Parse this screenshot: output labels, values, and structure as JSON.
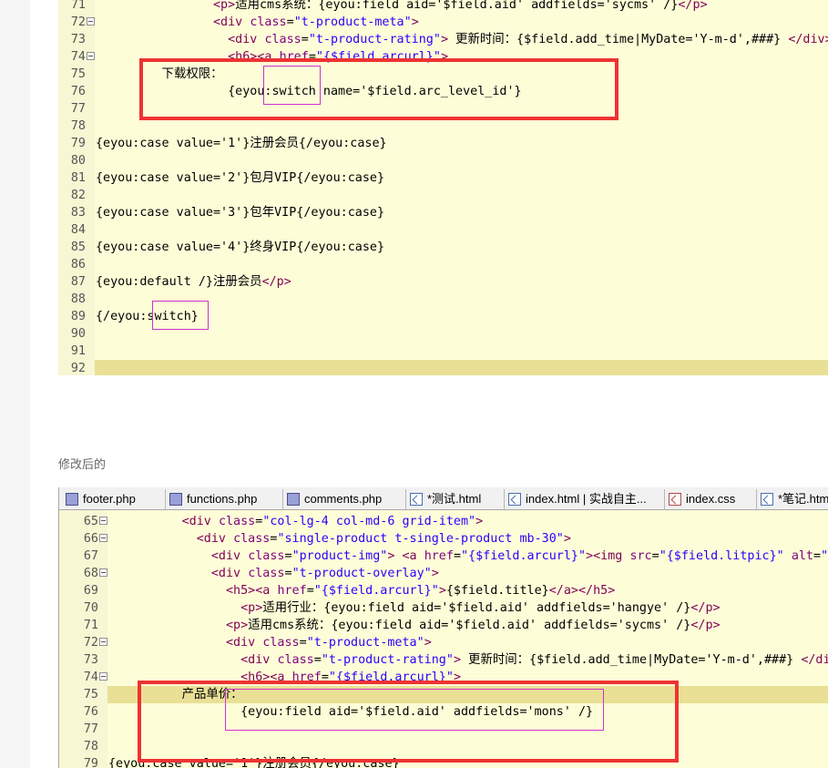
{
  "editor1": {
    "lines": [
      {
        "n": "71",
        "tokens": [
          [
            "",
            "                "
          ],
          [
            "k",
            "<p>"
          ],
          [
            "",
            "适用cms系统：{eyou:field aid='$field.aid' addfields='sycms' /}"
          ],
          [
            "k",
            "</p>"
          ]
        ]
      },
      {
        "n": "72",
        "fold": true,
        "tokens": [
          [
            "",
            "                "
          ],
          [
            "k",
            "<div "
          ],
          [
            "a",
            "class"
          ],
          [
            "",
            "="
          ],
          [
            "s",
            "\"t-product-meta\""
          ],
          [
            "k",
            ">"
          ]
        ]
      },
      {
        "n": "73",
        "tokens": [
          [
            "",
            "                  "
          ],
          [
            "k",
            "<div "
          ],
          [
            "a",
            "class"
          ],
          [
            "",
            "="
          ],
          [
            "s",
            "\"t-product-rating\""
          ],
          [
            "k",
            ">"
          ],
          [
            "",
            " 更新时间：{$field.add_time|MyDate='Y-m-d',###} "
          ],
          [
            "k",
            "</div>"
          ]
        ]
      },
      {
        "n": "74",
        "fold": true,
        "tokens": [
          [
            "",
            "                  "
          ],
          [
            "k",
            "<h6><a "
          ],
          [
            "a",
            "href"
          ],
          [
            "",
            "="
          ],
          [
            "s",
            "\"{$field.arcurl}\""
          ],
          [
            "k",
            ">"
          ]
        ]
      },
      {
        "n": "75",
        "tokens": [
          [
            "",
            "         下载权限："
          ]
        ]
      },
      {
        "n": "76",
        "tokens": [
          [
            "",
            "                  {eyou:switch name='$field.arc_level_id'}"
          ]
        ]
      },
      {
        "n": "77",
        "tokens": [
          [
            "",
            ""
          ]
        ]
      },
      {
        "n": "78",
        "tokens": [
          [
            "",
            ""
          ]
        ]
      },
      {
        "n": "79",
        "tokens": [
          [
            "",
            "{eyou:case value='1'}注册会员{/eyou:case}"
          ]
        ]
      },
      {
        "n": "80",
        "tokens": [
          [
            "",
            ""
          ]
        ]
      },
      {
        "n": "81",
        "tokens": [
          [
            "",
            "{eyou:case value='2'}包月VIP{/eyou:case}"
          ]
        ]
      },
      {
        "n": "82",
        "tokens": [
          [
            "",
            ""
          ]
        ]
      },
      {
        "n": "83",
        "tokens": [
          [
            "",
            "{eyou:case value='3'}包年VIP{/eyou:case}"
          ]
        ]
      },
      {
        "n": "84",
        "tokens": [
          [
            "",
            ""
          ]
        ]
      },
      {
        "n": "85",
        "tokens": [
          [
            "",
            "{eyou:case value='4'}终身VIP{/eyou:case}"
          ]
        ]
      },
      {
        "n": "86",
        "tokens": [
          [
            "",
            ""
          ]
        ]
      },
      {
        "n": "87",
        "tokens": [
          [
            "",
            "{eyou:default /}注册会员"
          ],
          [
            "k",
            "</p>"
          ]
        ]
      },
      {
        "n": "88",
        "tokens": [
          [
            "",
            ""
          ]
        ]
      },
      {
        "n": "89",
        "tokens": [
          [
            "",
            "{/eyou:switch}"
          ]
        ]
      },
      {
        "n": "90",
        "tokens": [
          [
            "",
            ""
          ]
        ]
      },
      {
        "n": "91",
        "tokens": [
          [
            "",
            ""
          ]
        ]
      },
      {
        "n": "92",
        "current": true,
        "tokens": [
          [
            "",
            ""
          ]
        ]
      }
    ]
  },
  "caption": "修改后的",
  "editor2": {
    "tabs": [
      {
        "label": "footer.php",
        "icon": "php-file-icon",
        "type": "php"
      },
      {
        "label": "functions.php",
        "icon": "php-file-icon",
        "type": "php"
      },
      {
        "label": "comments.php",
        "icon": "php-file-icon",
        "type": "php"
      },
      {
        "label": "*测试.html",
        "icon": "html-file-icon",
        "type": "html"
      },
      {
        "label": "index.html | 实战自主...",
        "icon": "html-file-icon",
        "type": "html"
      },
      {
        "label": "index.css",
        "icon": "css-file-icon",
        "type": "css"
      },
      {
        "label": "*笔记.html",
        "icon": "html-file-icon",
        "type": "html"
      }
    ],
    "lines": [
      {
        "n": "65",
        "fold": true,
        "tokens": [
          [
            "",
            "          "
          ],
          [
            "k",
            "<div "
          ],
          [
            "a",
            "class"
          ],
          [
            "",
            "="
          ],
          [
            "s",
            "\"col-lg-4 col-md-6 grid-item\""
          ],
          [
            "k",
            ">"
          ]
        ]
      },
      {
        "n": "66",
        "fold": true,
        "tokens": [
          [
            "",
            "            "
          ],
          [
            "k",
            "<div "
          ],
          [
            "a",
            "class"
          ],
          [
            "",
            "="
          ],
          [
            "s",
            "\"single-product t-single-product mb-30\""
          ],
          [
            "k",
            ">"
          ]
        ]
      },
      {
        "n": "67",
        "tokens": [
          [
            "",
            "              "
          ],
          [
            "k",
            "<div "
          ],
          [
            "a",
            "class"
          ],
          [
            "",
            "="
          ],
          [
            "s",
            "\"product-img\""
          ],
          [
            "k",
            "> <a "
          ],
          [
            "a",
            "href"
          ],
          [
            "",
            "="
          ],
          [
            "s",
            "\"{$field.arcurl}\""
          ],
          [
            "k",
            "><img "
          ],
          [
            "a",
            "src"
          ],
          [
            "",
            "="
          ],
          [
            "s",
            "\"{$field.litpic}\""
          ],
          [
            "",
            " "
          ],
          [
            "a",
            "alt"
          ],
          [
            "",
            "="
          ],
          [
            "s",
            "\"{"
          ]
        ]
      },
      {
        "n": "68",
        "fold": true,
        "tokens": [
          [
            "",
            "              "
          ],
          [
            "k",
            "<div "
          ],
          [
            "a",
            "class"
          ],
          [
            "",
            "="
          ],
          [
            "s",
            "\"t-product-overlay\""
          ],
          [
            "k",
            ">"
          ]
        ]
      },
      {
        "n": "69",
        "tokens": [
          [
            "",
            "                "
          ],
          [
            "k",
            "<h5><a "
          ],
          [
            "a",
            "href"
          ],
          [
            "",
            "="
          ],
          [
            "s",
            "\"{$field.arcurl}\""
          ],
          [
            "k",
            ">"
          ],
          [
            "",
            "{$field.title}"
          ],
          [
            "k",
            "</a></h5>"
          ]
        ]
      },
      {
        "n": "70",
        "tokens": [
          [
            "",
            "                  "
          ],
          [
            "k",
            "<p>"
          ],
          [
            "",
            "适用行业：{eyou:field aid='$field.aid' addfields='hangye' /}"
          ],
          [
            "k",
            "</p>"
          ]
        ]
      },
      {
        "n": "71",
        "tokens": [
          [
            "",
            "                "
          ],
          [
            "k",
            "<p>"
          ],
          [
            "",
            "适用cms系统：{eyou:field aid='$field.aid' addfields='sycms' /}"
          ],
          [
            "k",
            "</p>"
          ]
        ]
      },
      {
        "n": "72",
        "fold": true,
        "tokens": [
          [
            "",
            "                "
          ],
          [
            "k",
            "<div "
          ],
          [
            "a",
            "class"
          ],
          [
            "",
            "="
          ],
          [
            "s",
            "\"t-product-meta\""
          ],
          [
            "k",
            ">"
          ]
        ]
      },
      {
        "n": "73",
        "tokens": [
          [
            "",
            "                  "
          ],
          [
            "k",
            "<div "
          ],
          [
            "a",
            "class"
          ],
          [
            "",
            "="
          ],
          [
            "s",
            "\"t-product-rating\""
          ],
          [
            "k",
            ">"
          ],
          [
            "",
            " 更新时间：{$field.add_time|MyDate='Y-m-d',###} "
          ],
          [
            "k",
            "</di"
          ]
        ]
      },
      {
        "n": "74",
        "fold": true,
        "tokens": [
          [
            "",
            "                  "
          ],
          [
            "k",
            "<h6><a "
          ],
          [
            "a",
            "href"
          ],
          [
            "",
            "="
          ],
          [
            "s",
            "\"{$field.arcurl}\""
          ],
          [
            "k",
            ">"
          ]
        ]
      },
      {
        "n": "75",
        "current": true,
        "tokens": [
          [
            "",
            "          产品单价："
          ]
        ]
      },
      {
        "n": "76",
        "tokens": [
          [
            "",
            "                  {eyou:field aid='$field.aid' addfields='mons' /}"
          ]
        ]
      },
      {
        "n": "77",
        "tokens": [
          [
            "",
            ""
          ]
        ]
      },
      {
        "n": "78",
        "tokens": [
          [
            "",
            ""
          ]
        ]
      },
      {
        "n": "79",
        "tokens": [
          [
            "",
            "{eyou:case value='1'}注册会员{/eyou:case}"
          ]
        ]
      }
    ]
  }
}
